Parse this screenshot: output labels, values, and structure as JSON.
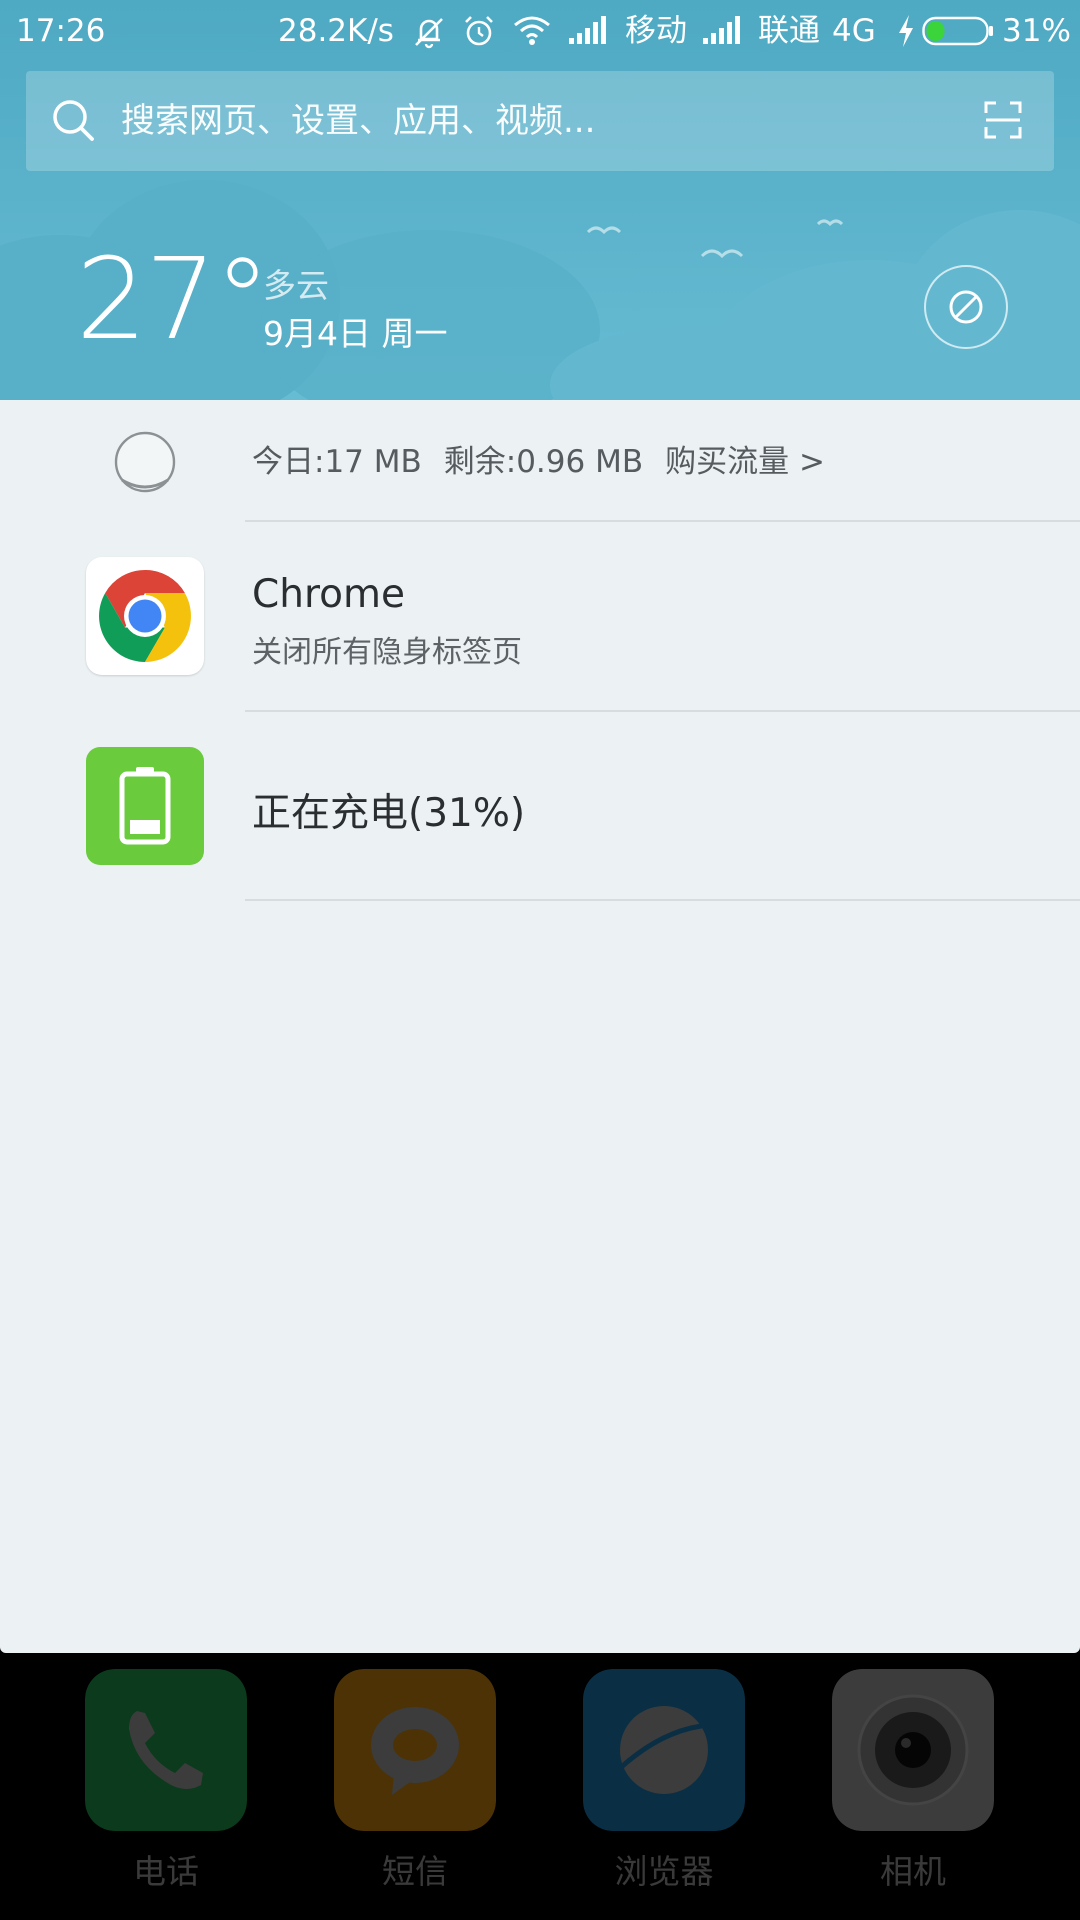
{
  "status_bar": {
    "time": "17:26",
    "net_speed": "28.2K/s",
    "carrier_1": "移动",
    "carrier_2": "联通",
    "network_type": "4G",
    "battery_percent": "31%",
    "battery_level": 0.31,
    "icons": [
      "mute-bell-icon",
      "alarm-icon",
      "wifi-icon",
      "signal-icon",
      "signal-icon",
      "charging-bolt-icon",
      "battery-icon"
    ]
  },
  "search": {
    "placeholder": "搜索网页、设置、应用、视频..."
  },
  "weather": {
    "temperature": "27°",
    "condition": "多云",
    "date": "9月4日 周一"
  },
  "data_usage": {
    "today": "今日:17 MB",
    "remaining": "剩余:0.96 MB",
    "buy_link": "购买流量 >"
  },
  "notifications": [
    {
      "app": "Chrome",
      "title": "Chrome",
      "subtitle": "关闭所有隐身标签页",
      "icon": "chrome-icon"
    },
    {
      "app": "battery",
      "title": "正在充电(31%)",
      "icon": "battery-charging-icon"
    }
  ],
  "dock": {
    "items": [
      {
        "label": "电话",
        "icon": "phone-icon",
        "color": "#0b3a1c"
      },
      {
        "label": "短信",
        "icon": "message-icon",
        "color": "#4d3206"
      },
      {
        "label": "浏览器",
        "icon": "browser-icon",
        "color": "#0a2f45"
      },
      {
        "label": "相机",
        "icon": "camera-icon",
        "color": "#3c3c3c"
      }
    ]
  },
  "colors": {
    "header_sky": "#5db4cc",
    "panel_bg": "#ecf2f4",
    "battery_green": "#6acb3d"
  }
}
